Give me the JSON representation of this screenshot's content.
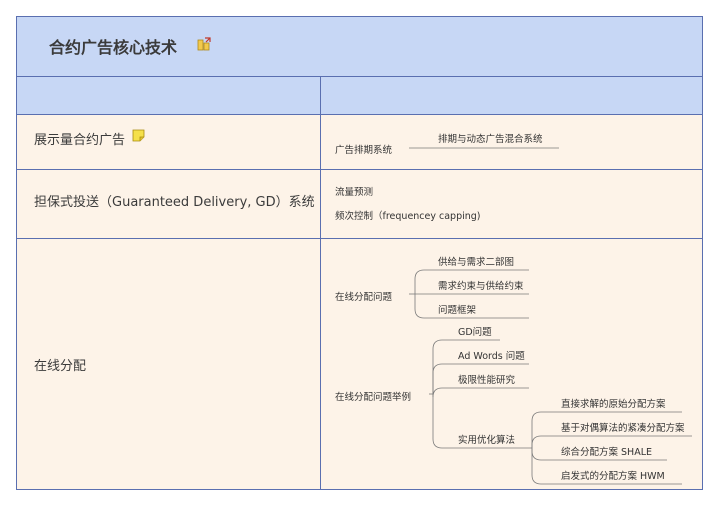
{
  "title": "合约广告核心技术",
  "rows": {
    "r1": {
      "label": "展示量合约广告",
      "node": "广告排期系统",
      "child": "排期与动态广告混合系统"
    },
    "r2": {
      "label": "担保式投送（Guaranteed Delivery, GD）系统",
      "items": [
        "流量预测",
        "频次控制（frequencey capping)"
      ]
    },
    "r3": {
      "label": "在线分配",
      "node_a": "在线分配问题",
      "node_a_children": [
        "供给与需求二部图",
        "需求约束与供给约束",
        "问题框架"
      ],
      "node_b": "在线分配问题举例",
      "node_b_children": [
        "GD问题",
        "Ad Words 问题",
        "极限性能研究",
        "实用优化算法"
      ],
      "algo_children": [
        "直接求解的原始分配方案",
        "基于对偶算法的紧凑分配方案",
        "综合分配方案 SHALE",
        "启发式的分配方案 HWM"
      ]
    }
  },
  "colors": {
    "header_bg": "#c7d7f5",
    "row_bg": "#fdf3e8",
    "border": "#5a6fb0",
    "note_icon": "#f5e04a"
  }
}
